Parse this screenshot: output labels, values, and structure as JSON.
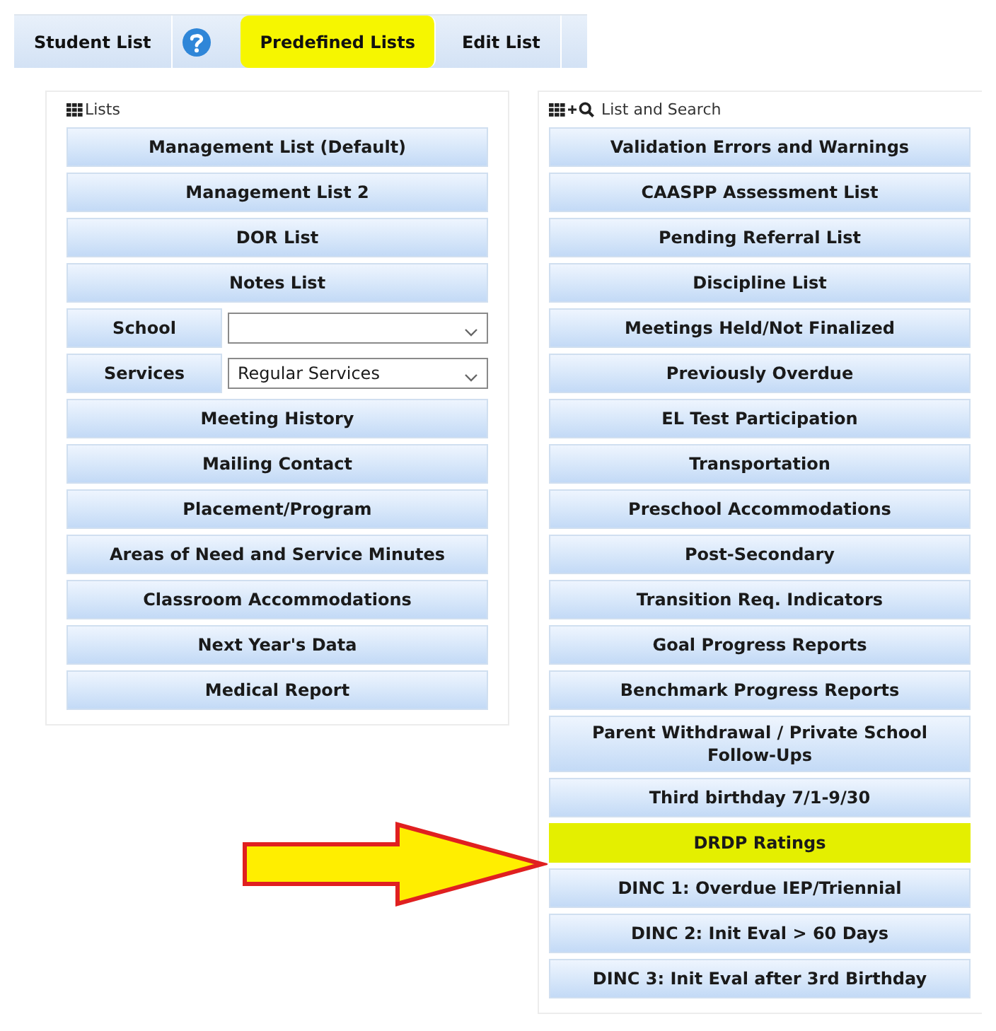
{
  "tabs": [
    {
      "kind": "tab",
      "label": "Student List",
      "highlighted": false
    },
    {
      "kind": "help"
    },
    {
      "kind": "tab",
      "label": "Predefined Lists",
      "highlighted": true
    },
    {
      "kind": "tab",
      "label": "Edit List",
      "highlighted": false
    }
  ],
  "lists_panel": {
    "title": "Lists",
    "items": [
      {
        "kind": "button",
        "label": "Management List (Default)",
        "highlighted": false
      },
      {
        "kind": "button",
        "label": "Management List 2",
        "highlighted": false
      },
      {
        "kind": "button",
        "label": "DOR List",
        "highlighted": false
      },
      {
        "kind": "button",
        "label": "Notes List",
        "highlighted": false
      },
      {
        "kind": "select",
        "label": "School"
      },
      {
        "kind": "select",
        "label": "Services",
        "value": "Regular Services"
      },
      {
        "kind": "button",
        "label": "Meeting History",
        "highlighted": false
      },
      {
        "kind": "button",
        "label": "Mailing Contact",
        "highlighted": false
      },
      {
        "kind": "button",
        "label": "Placement/Program",
        "highlighted": false
      },
      {
        "kind": "button",
        "label": "Areas of Need and Service Minutes",
        "highlighted": false
      },
      {
        "kind": "button",
        "label": "Classroom Accommodations",
        "highlighted": false
      },
      {
        "kind": "button",
        "label": "Next Year's Data",
        "highlighted": false
      },
      {
        "kind": "button",
        "label": "Medical Report",
        "highlighted": false
      }
    ]
  },
  "search_panel": {
    "title": "List and Search",
    "items": [
      {
        "kind": "button",
        "label": "Validation Errors and Warnings",
        "highlighted": false
      },
      {
        "kind": "button",
        "label": "CAASPP Assessment List",
        "highlighted": false
      },
      {
        "kind": "button",
        "label": "Pending Referral List",
        "highlighted": false
      },
      {
        "kind": "button",
        "label": "Discipline List",
        "highlighted": false
      },
      {
        "kind": "button",
        "label": "Meetings Held/Not Finalized",
        "highlighted": false
      },
      {
        "kind": "button",
        "label": "Previously Overdue",
        "highlighted": false
      },
      {
        "kind": "button",
        "label": "EL Test Participation",
        "highlighted": false
      },
      {
        "kind": "button",
        "label": "Transportation",
        "highlighted": false
      },
      {
        "kind": "button",
        "label": "Preschool Accommodations",
        "highlighted": false
      },
      {
        "kind": "button",
        "label": "Post-Secondary",
        "highlighted": false
      },
      {
        "kind": "button",
        "label": "Transition Req. Indicators",
        "highlighted": false
      },
      {
        "kind": "button",
        "label": "Goal Progress Reports",
        "highlighted": false
      },
      {
        "kind": "button",
        "label": "Benchmark Progress Reports",
        "highlighted": false
      },
      {
        "kind": "button",
        "label": "Parent Withdrawal / Private School Follow-Ups",
        "highlighted": false
      },
      {
        "kind": "button",
        "label": "Third birthday 7/1-9/30",
        "highlighted": false
      },
      {
        "kind": "button",
        "label": "DRDP Ratings",
        "highlighted": true
      },
      {
        "kind": "button",
        "label": "DINC 1: Overdue IEP/Triennial",
        "highlighted": false
      },
      {
        "kind": "button",
        "label": "DINC 2: Init Eval > 60 Days",
        "highlighted": false
      },
      {
        "kind": "button",
        "label": "DINC 3: Init Eval after 3rd Birthday",
        "highlighted": false
      }
    ]
  },
  "annotation": {
    "kind": "arrow"
  }
}
